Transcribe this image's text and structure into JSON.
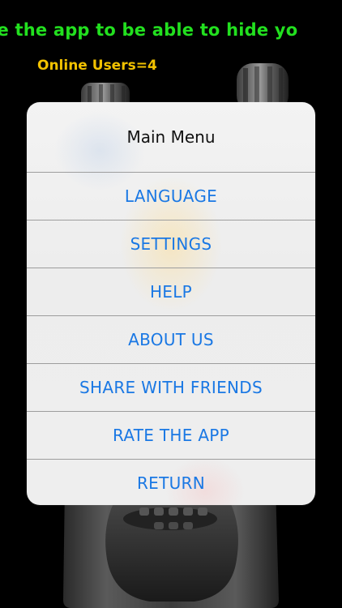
{
  "marquee": {
    "text": "scribe the app to be able to hide yo"
  },
  "status": {
    "online_users": "Online Users=4"
  },
  "colors": {
    "marquee": "#22e01f",
    "online_users": "#f2c200",
    "menu_link": "#1a78e4",
    "menu_bg": "#efefef"
  },
  "menu": {
    "title": "Main Menu",
    "items": [
      {
        "label": "LANGUAGE"
      },
      {
        "label": "SETTINGS"
      },
      {
        "label": "HELP"
      },
      {
        "label": "ABOUT US"
      },
      {
        "label": "SHARE WITH FRIENDS"
      },
      {
        "label": "RATE THE APP"
      },
      {
        "label": "RETURN"
      }
    ]
  }
}
